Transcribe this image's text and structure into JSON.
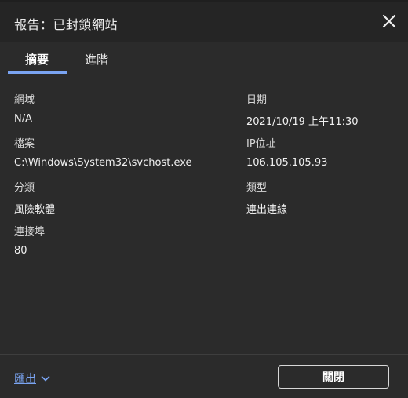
{
  "dialog": {
    "title": "報告：已封鎖網站",
    "close_icon": "close-icon"
  },
  "tabs": [
    {
      "label": "摘要",
      "active": true
    },
    {
      "label": "進階",
      "active": false
    }
  ],
  "fields": {
    "domain": {
      "label": "網域",
      "value": "N/A"
    },
    "date": {
      "label": "日期",
      "value": "2021/10/19 上午11:30"
    },
    "file": {
      "label": "檔案",
      "value": "C:\\Windows\\System32\\svchost.exe"
    },
    "ip": {
      "label": "IP位址",
      "value": "106.105.105.93"
    },
    "category": {
      "label": "分類",
      "value": "風險軟體"
    },
    "type": {
      "label": "類型",
      "value": "連出連線"
    },
    "port": {
      "label": "連接埠",
      "value": "80"
    }
  },
  "footer": {
    "export_label": "匯出",
    "close_label": "關閉"
  },
  "colors": {
    "accent": "#7aa4f2",
    "background": "#2b2b2b",
    "titlebar": "#252525"
  }
}
